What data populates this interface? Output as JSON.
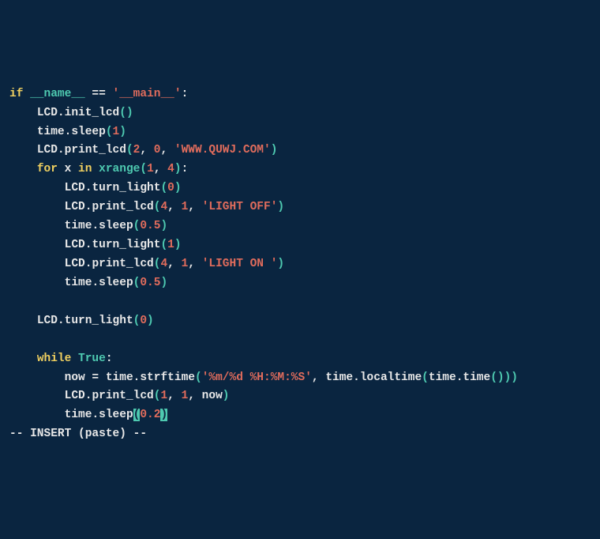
{
  "code": {
    "l1": {
      "kw": "if",
      "dunder": "__name__",
      "eq": " == ",
      "str": "'__main__'",
      "colon": ":"
    },
    "l2": {
      "obj": "LCD",
      "dot": ".",
      "fn": "init_lcd",
      "args": "()"
    },
    "l3": {
      "obj": "time",
      "dot": ".",
      "fn": "sleep",
      "lp": "(",
      "num": "1",
      "rp": ")"
    },
    "l4": {
      "obj": "LCD",
      "dot": ".",
      "fn": "print_lcd",
      "lp": "(",
      "n1": "2",
      "c1": ", ",
      "n2": "0",
      "c2": ", ",
      "str": "'WWW.QUWJ.COM'",
      "rp": ")"
    },
    "l5": {
      "kw1": "for",
      "var": " x ",
      "kw2": "in",
      "sp": " ",
      "fn": "xrange",
      "lp": "(",
      "n1": "1",
      "c1": ", ",
      "n2": "4",
      "rp": ")",
      "colon": ":"
    },
    "l6": {
      "obj": "LCD",
      "dot": ".",
      "fn": "turn_light",
      "lp": "(",
      "num": "0",
      "rp": ")"
    },
    "l7": {
      "obj": "LCD",
      "dot": ".",
      "fn": "print_lcd",
      "lp": "(",
      "n1": "4",
      "c1": ", ",
      "n2": "1",
      "c2": ", ",
      "str": "'LIGHT OFF'",
      "rp": ")"
    },
    "l8": {
      "obj": "time",
      "dot": ".",
      "fn": "sleep",
      "lp": "(",
      "num": "0.5",
      "rp": ")"
    },
    "l9": {
      "obj": "LCD",
      "dot": ".",
      "fn": "turn_light",
      "lp": "(",
      "num": "1",
      "rp": ")"
    },
    "l10": {
      "obj": "LCD",
      "dot": ".",
      "fn": "print_lcd",
      "lp": "(",
      "n1": "4",
      "c1": ", ",
      "n2": "1",
      "c2": ", ",
      "str": "'LIGHT ON '",
      "rp": ")"
    },
    "l11": {
      "obj": "time",
      "dot": ".",
      "fn": "sleep",
      "lp": "(",
      "num": "0.5",
      "rp": ")"
    },
    "l12": {
      "obj": "LCD",
      "dot": ".",
      "fn": "turn_light",
      "lp": "(",
      "num": "0",
      "rp": ")"
    },
    "l13": {
      "kw": "while",
      "sp": " ",
      "bool": "True",
      "colon": ":"
    },
    "l14": {
      "var": "now = ",
      "obj": "time",
      "dot": ".",
      "fn": "strftime",
      "lp": "(",
      "str": "'%m/%d %H:%M:%S'",
      "c1": ", ",
      "obj2": "time",
      "dot2": ".",
      "fn2": "localtime",
      "lp2": "(",
      "obj3": "time",
      "dot3": ".",
      "fn3": "time",
      "lp3": "()))"
    },
    "l15": {
      "obj": "LCD",
      "dot": ".",
      "fn": "print_lcd",
      "lp": "(",
      "n1": "1",
      "c1": ", ",
      "n2": "1",
      "c2": ", now",
      "rp": ")"
    },
    "l16": {
      "obj": "time",
      "dot": ".",
      "fn": "sleep",
      "lp": "(",
      "num": "0.2",
      "rp": ")"
    }
  },
  "status": "-- INSERT (paste) --"
}
